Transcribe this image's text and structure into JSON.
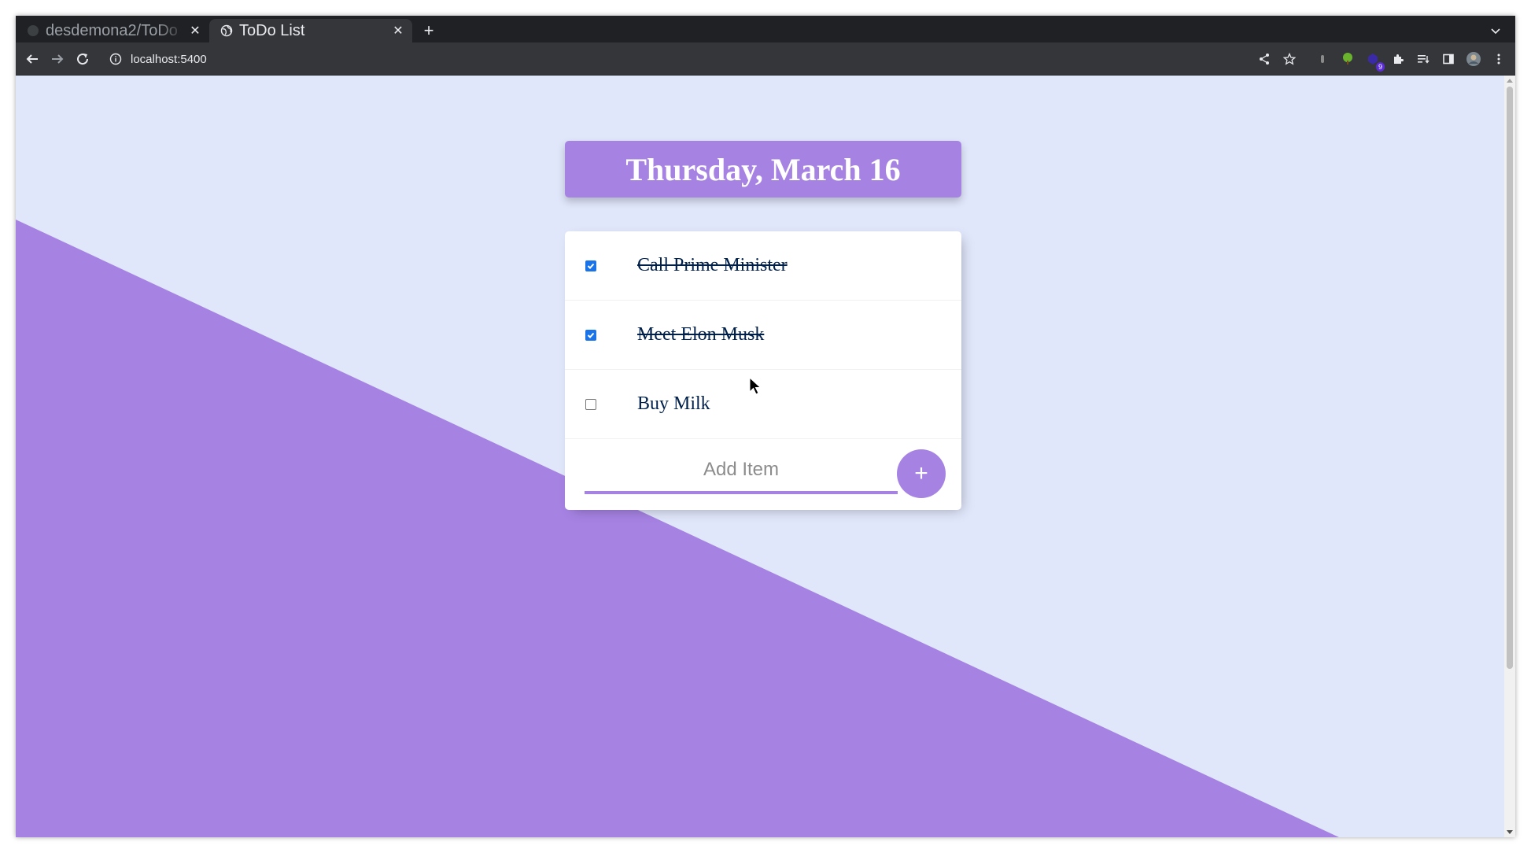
{
  "browser": {
    "tabs": [
      {
        "title": "desdemona2/ToDo",
        "active": false
      },
      {
        "title": "ToDo List",
        "active": true
      }
    ],
    "url": "localhost:5400",
    "extension_badge": "9"
  },
  "app": {
    "date_heading": "Thursday, March 16",
    "items": [
      {
        "label": "Call Prime Minister",
        "checked": true
      },
      {
        "label": "Meet Elon Musk",
        "checked": true
      },
      {
        "label": "Buy Milk",
        "checked": false
      }
    ],
    "add_placeholder": "Add Item",
    "add_button_label": "+"
  },
  "colors": {
    "accent": "#a683e3",
    "page_background": "#e1e7fb",
    "item_text": "#00204a",
    "checkbox": "#1a73e8"
  }
}
